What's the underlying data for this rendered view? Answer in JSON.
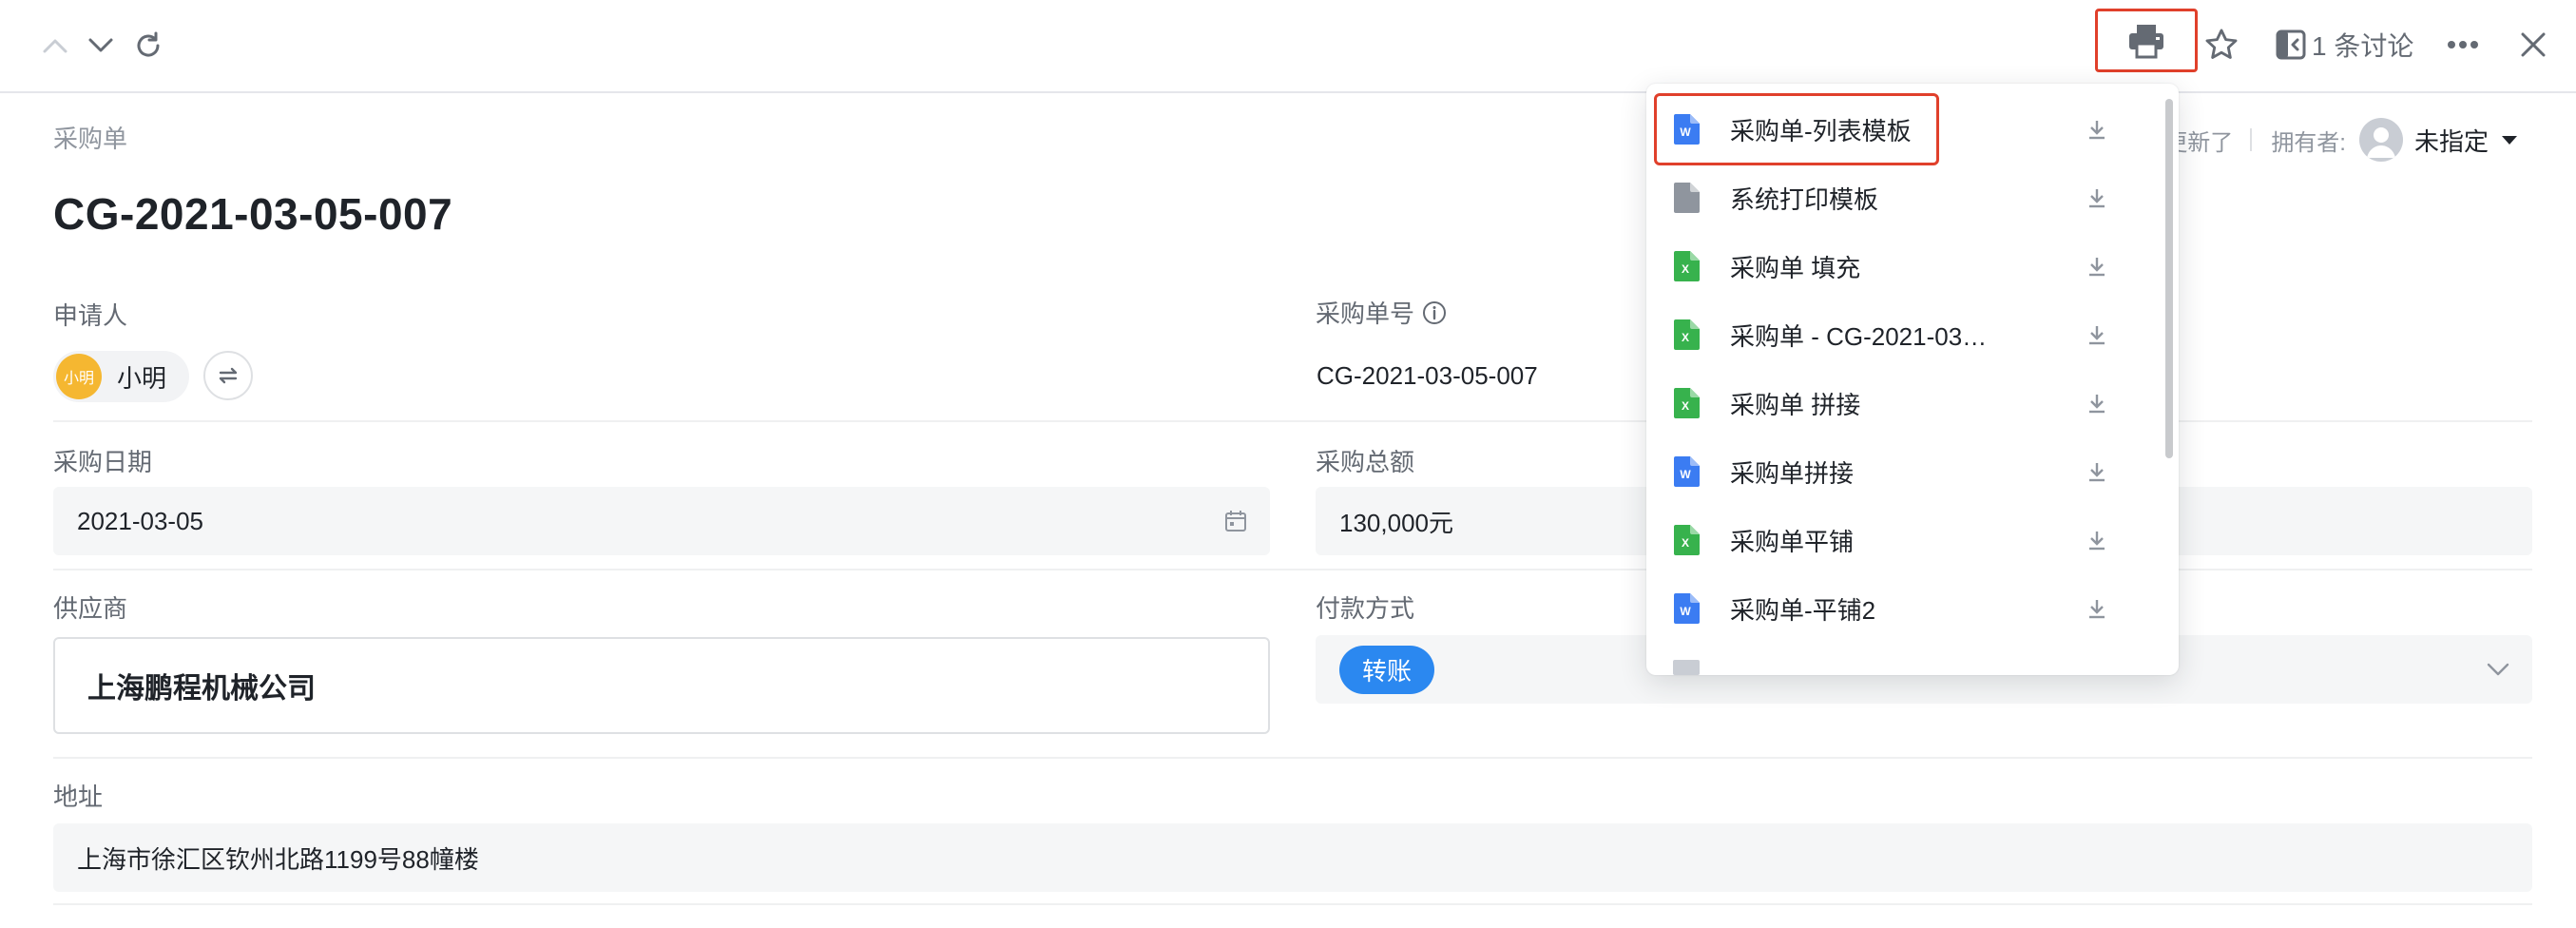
{
  "toolbar": {
    "discussion_label": "1 条讨论"
  },
  "header": {
    "breadcrumb": "采购单",
    "title": "CG-2021-03-05-007",
    "updated_text": "更新了",
    "owner_label": "拥有者:",
    "owner_value": "未指定"
  },
  "fields": {
    "applicant": {
      "label": "申请人",
      "avatar_text": "小明",
      "name": "小明"
    },
    "order_no": {
      "label": "采购单号",
      "value": "CG-2021-03-05-007"
    },
    "date": {
      "label": "采购日期",
      "value": "2021-03-05"
    },
    "total": {
      "label": "采购总额",
      "value": "130,000元"
    },
    "supplier": {
      "label": "供应商",
      "value": "上海鹏程机械公司"
    },
    "payment": {
      "label": "付款方式",
      "value": "转账"
    },
    "address": {
      "label": "地址",
      "value": "上海市徐汇区钦州北路1199号88幢楼"
    }
  },
  "print_menu": {
    "items": [
      {
        "label": "采购单-列表模板",
        "type": "word"
      },
      {
        "label": "系统打印模板",
        "type": "doc"
      },
      {
        "label": "采购单 填充",
        "type": "excel"
      },
      {
        "label": "采购单 - CG-2021-03…",
        "type": "excel"
      },
      {
        "label": "采购单 拼接",
        "type": "excel"
      },
      {
        "label": "采购单拼接",
        "type": "word"
      },
      {
        "label": "采购单平铺",
        "type": "excel"
      },
      {
        "label": "采购单-平铺2",
        "type": "word"
      }
    ]
  },
  "colors": {
    "highlight": "#e0402b",
    "word_icon": "#3b7cf2",
    "excel_icon": "#37b24d",
    "tag_blue": "#2b88f0",
    "avatar_yellow": "#f5b731"
  },
  "icons": {
    "word": "W",
    "excel": "X"
  }
}
